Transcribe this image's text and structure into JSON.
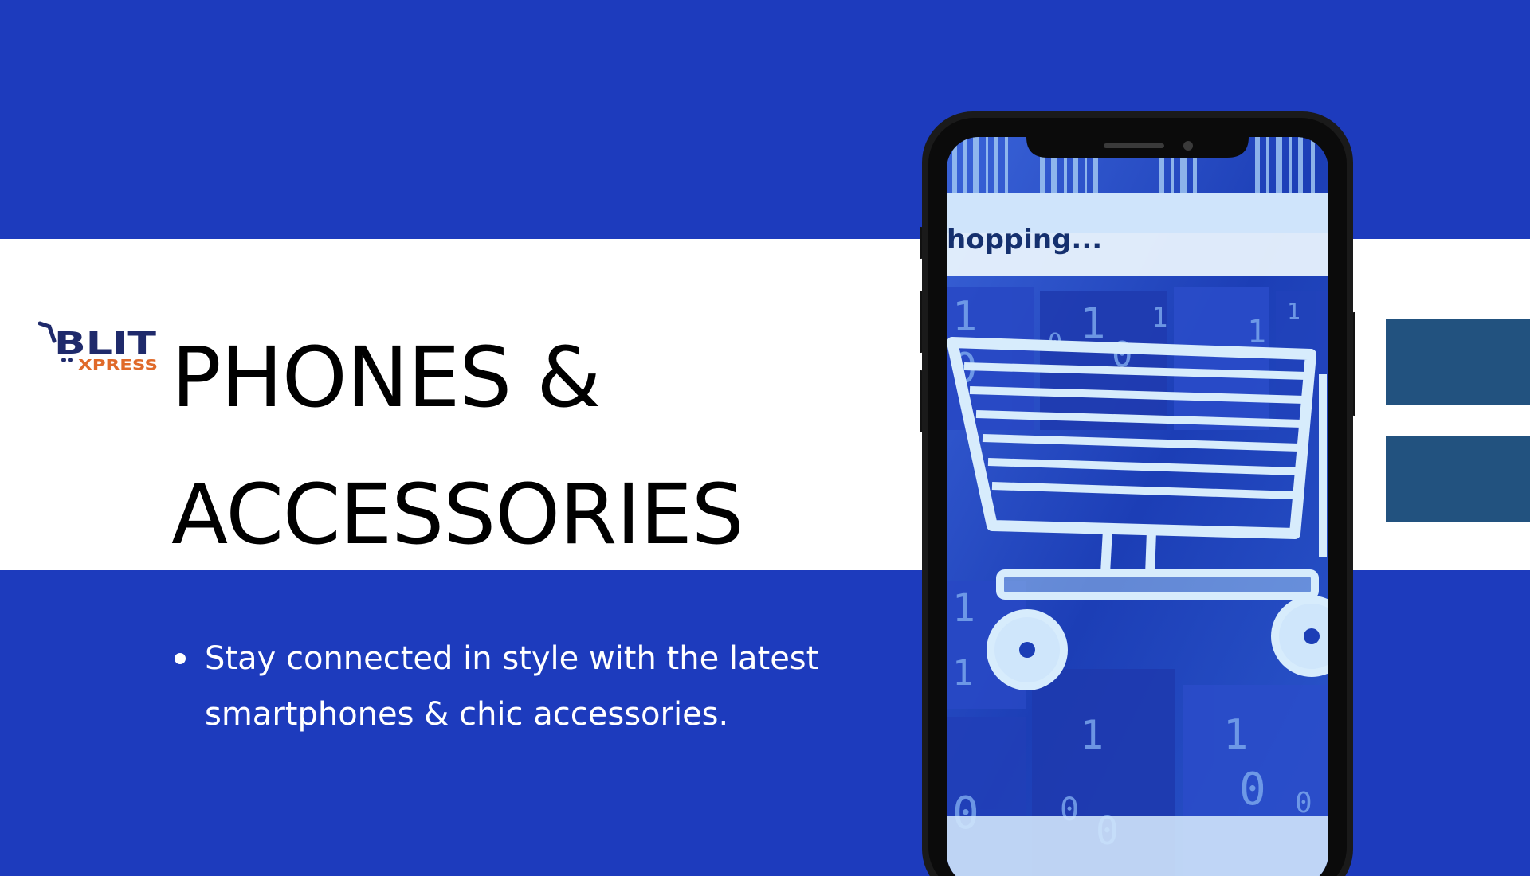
{
  "logo": {
    "brand_top": "BLIT",
    "brand_bottom": "XPRESS",
    "icon": "shopping-cart-logo"
  },
  "title": {
    "line1": "PHONES & ",
    "line2": "ACCESSORIES"
  },
  "bullets": [
    {
      "line1": "Stay connected in style with the latest",
      "line2": "smartphones & chic accessories."
    }
  ],
  "phone_screen": {
    "banner_text": "hopping...",
    "icon": "shopping-cart-icon"
  },
  "colors": {
    "background_blue": "#1d3bbd",
    "band_white": "#ffffff",
    "deco_blocks": "#22527f",
    "logo_navy": "#1f2a6b",
    "logo_orange": "#e06a2a"
  }
}
